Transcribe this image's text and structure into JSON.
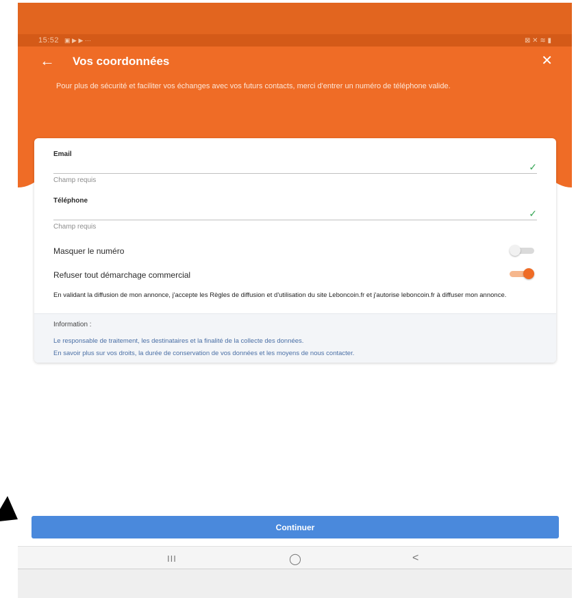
{
  "status_bar": {
    "time": "15:52",
    "left_icons": "▣ ▶ ▶ ···",
    "right_icons": "⊠ ✕ ≋ ▮"
  },
  "header": {
    "back_icon": "arrow-left-icon",
    "title": "Vos coordonnées",
    "close_icon": "close-icon",
    "intro": "Pour plus de sécurité et faciliter vos échanges avec vos futurs contacts, merci d'entrer un numéro de téléphone valide."
  },
  "form": {
    "email": {
      "label": "Email",
      "value": "",
      "hint": "Champ requis"
    },
    "phone": {
      "label": "Téléphone",
      "value": "",
      "hint": "Champ requis"
    },
    "hide_number": {
      "label": "Masquer le numéro",
      "enabled": false
    },
    "refuse_marketing": {
      "label": "Refuser tout démarchage commercial",
      "enabled": true
    },
    "legal": "En validant la diffusion de mon annonce, j'accepte les Règles de diffusion et d'utilisation du site Leboncoin.fr et j'autorise leboncoin.fr à diffuser mon annonce."
  },
  "information": {
    "title": "Information :",
    "link1": "Le responsable de traitement, les destinataires et la finalité de la collecte des données.",
    "link2": "En savoir plus sur vos droits, la durée de conservation de vos données et les moyens de nous contacter."
  },
  "continue_label": "Continuer",
  "nav": {
    "recents": "III",
    "home": "◯",
    "back": "<"
  },
  "colors": {
    "accent": "#ef6c26",
    "button": "#4a89dc",
    "valid": "#3aa758"
  }
}
